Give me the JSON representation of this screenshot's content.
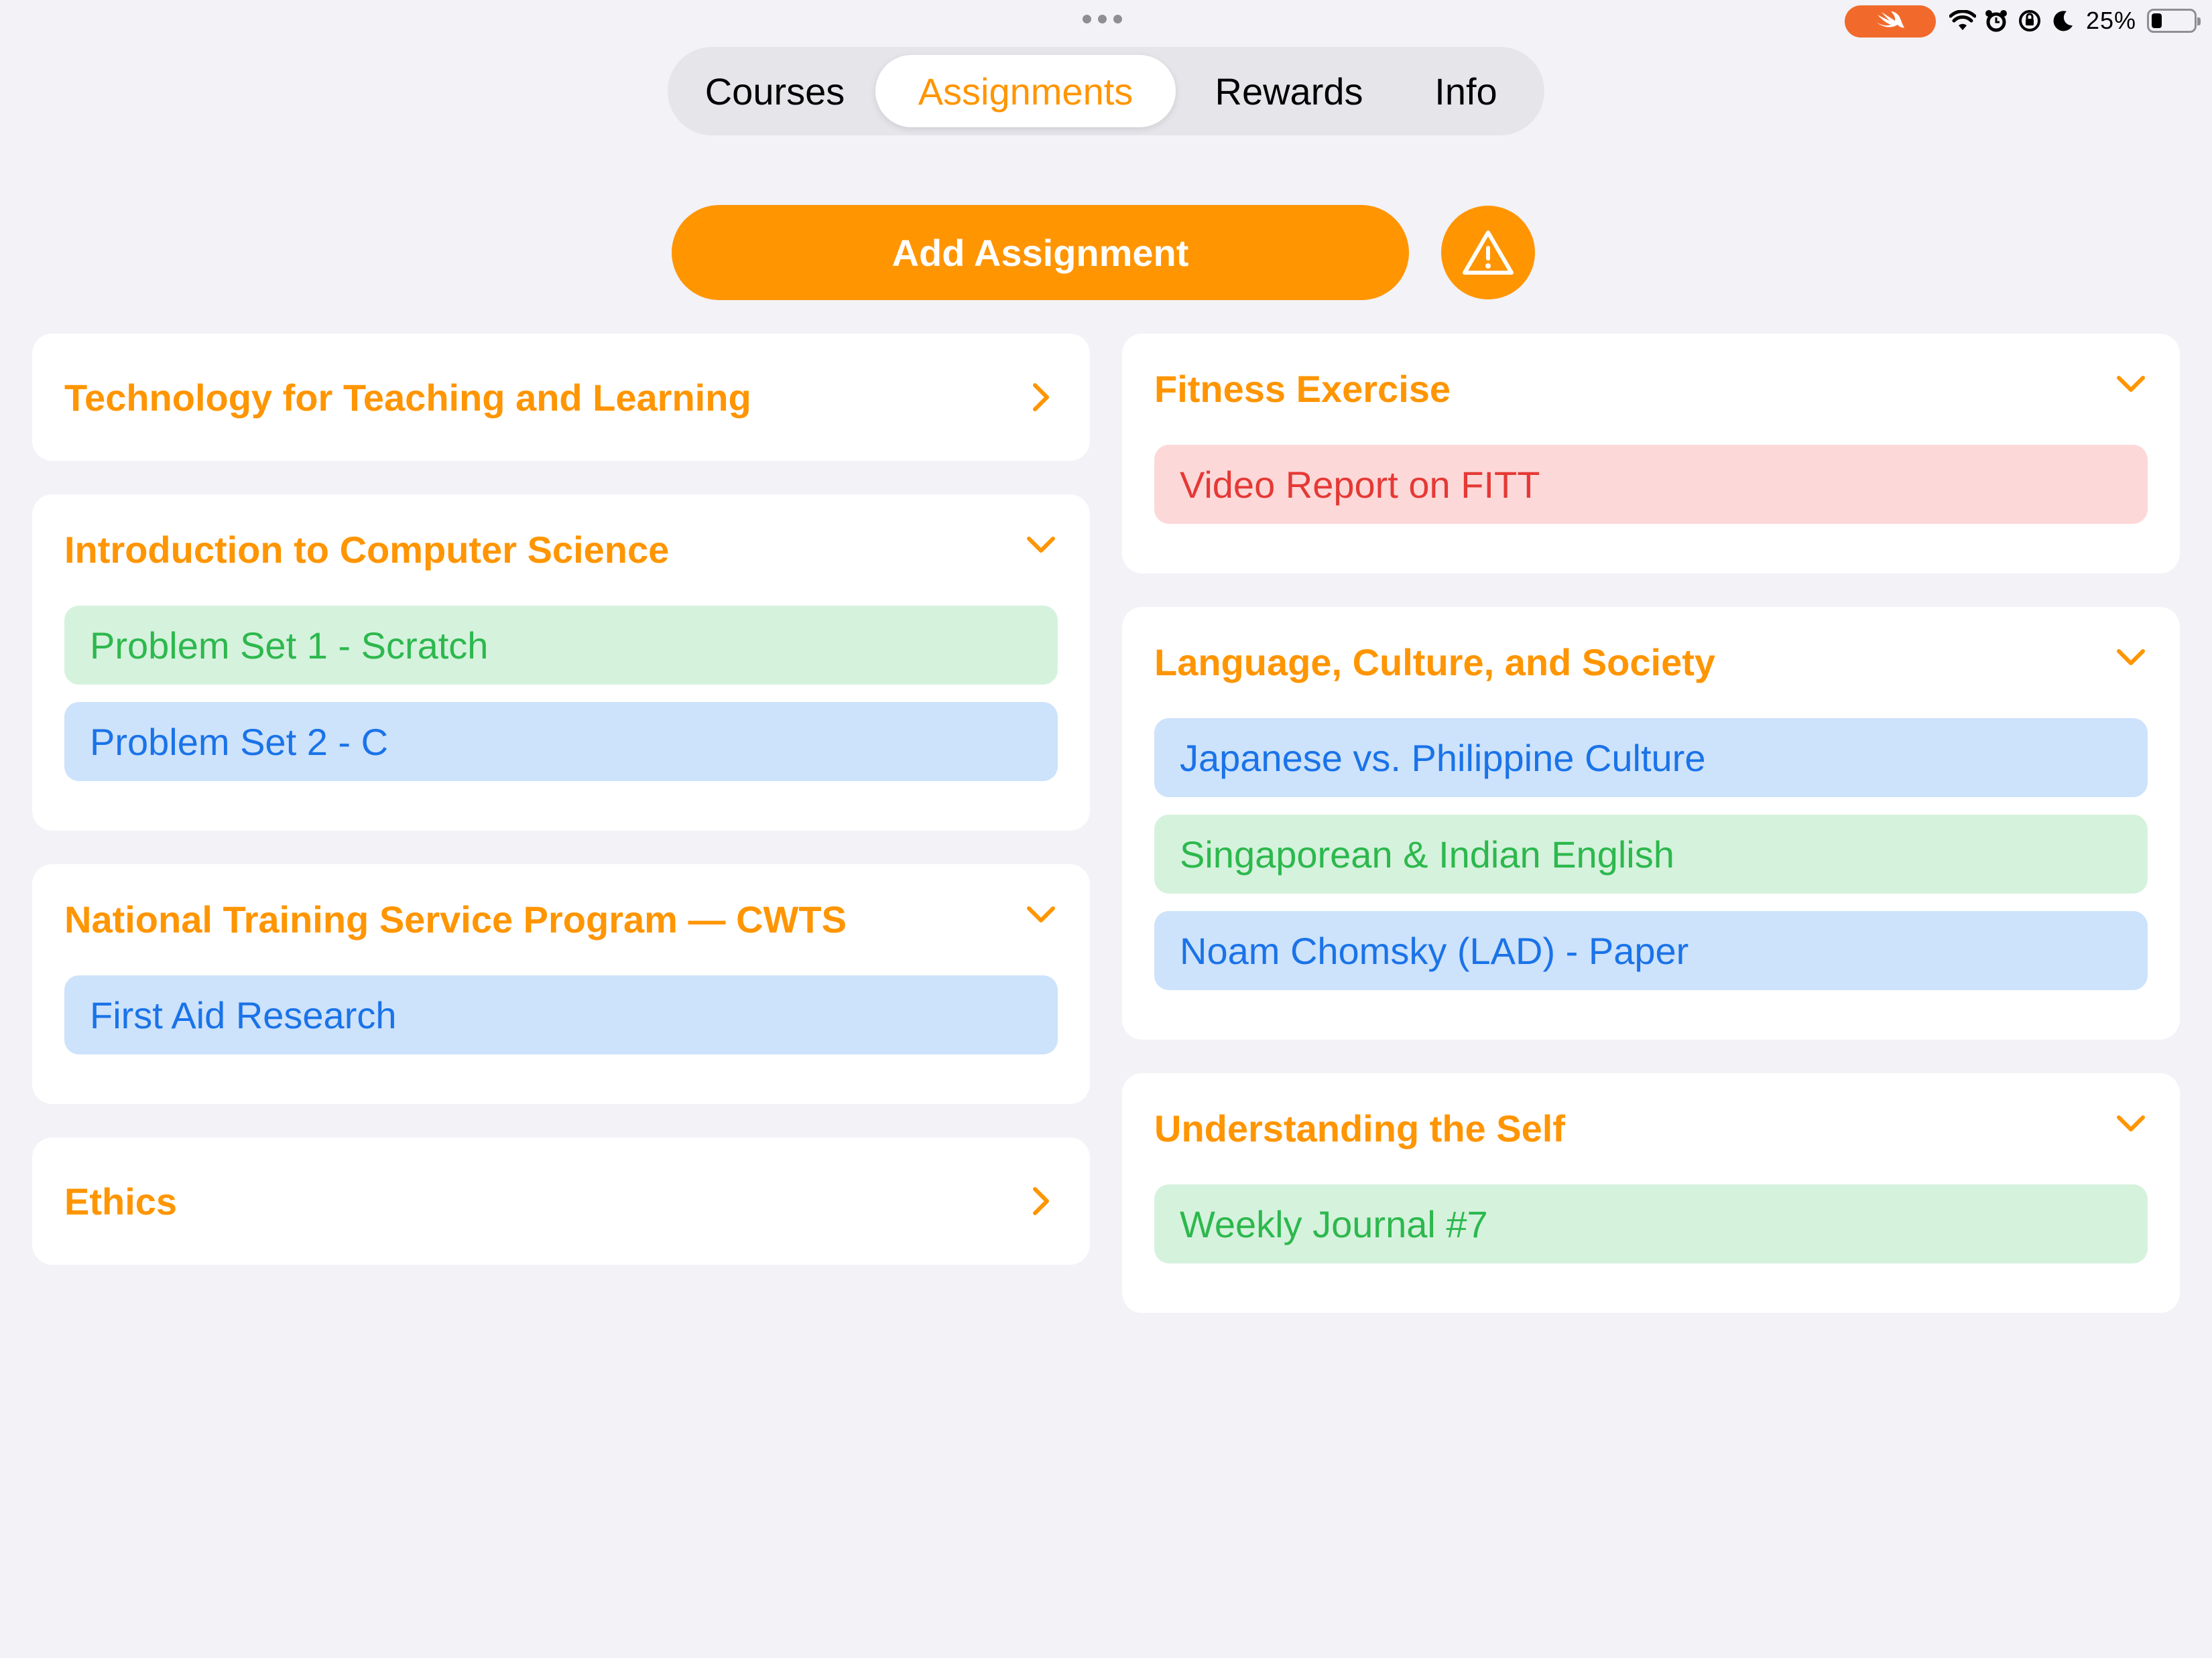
{
  "status_bar": {
    "battery_percent": "25%",
    "battery_level": 0.25,
    "icons": [
      "swift-icon",
      "wifi-icon",
      "alarm-icon",
      "orientation-lock-icon",
      "moon-icon",
      "battery-icon"
    ]
  },
  "tabs": [
    {
      "label": "Courses",
      "active": false
    },
    {
      "label": "Assignments",
      "active": true
    },
    {
      "label": "Rewards",
      "active": false
    },
    {
      "label": "Info",
      "active": false
    }
  ],
  "actions": {
    "add_label": "Add Assignment",
    "warning_icon": "warning-icon"
  },
  "colors": {
    "accent": "#FF9500",
    "green_bg": "#D5F2DD",
    "green_text": "#2DB84D",
    "blue_bg": "#CDE2FB",
    "blue_text": "#1A73E8",
    "red_bg": "#FDD8D8",
    "red_text": "#E53935"
  },
  "left_courses": [
    {
      "title": "Technology for Teaching and Learning",
      "expanded": false,
      "items": []
    },
    {
      "title": "Introduction to Computer Science",
      "expanded": true,
      "items": [
        {
          "label": "Problem Set 1 - Scratch",
          "color": "green"
        },
        {
          "label": "Problem Set 2 - C",
          "color": "blue"
        }
      ]
    },
    {
      "title": "National Training Service Program — CWTS",
      "expanded": true,
      "items": [
        {
          "label": "First Aid Research",
          "color": "blue"
        }
      ]
    },
    {
      "title": "Ethics",
      "expanded": false,
      "items": []
    }
  ],
  "right_courses": [
    {
      "title": "Fitness Exercise",
      "expanded": true,
      "items": [
        {
          "label": "Video Report on FITT",
          "color": "red"
        }
      ]
    },
    {
      "title": "Language, Culture, and Society",
      "expanded": true,
      "items": [
        {
          "label": "Japanese vs. Philippine Culture",
          "color": "blue"
        },
        {
          "label": "Singaporean & Indian English",
          "color": "green"
        },
        {
          "label": "Noam Chomsky (LAD) - Paper",
          "color": "blue"
        }
      ]
    },
    {
      "title": "Understanding the Self",
      "expanded": true,
      "items": [
        {
          "label": "Weekly Journal #7",
          "color": "green"
        }
      ]
    }
  ]
}
